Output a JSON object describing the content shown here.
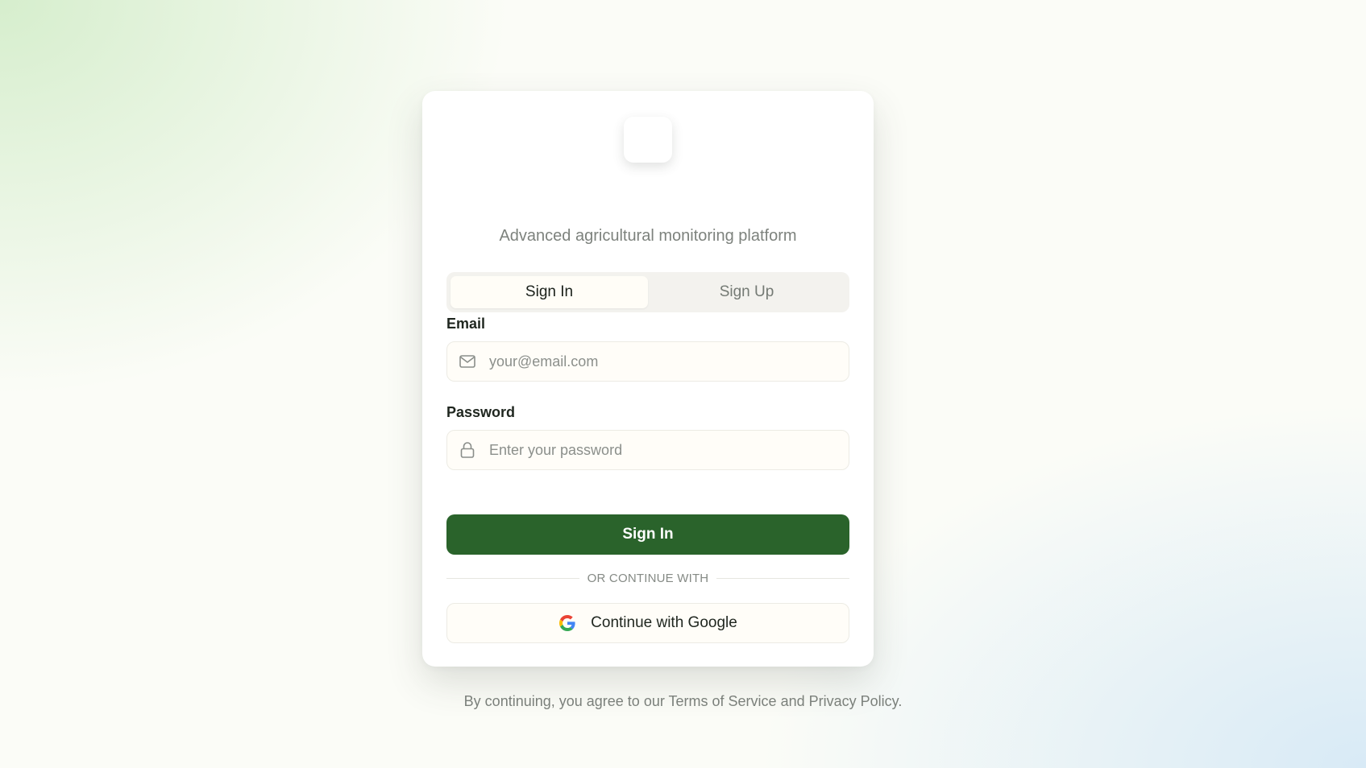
{
  "brand": {
    "subtitle": "Advanced agricultural monitoring platform",
    "logo_icon": "app-logo"
  },
  "tabs": [
    {
      "label": "Sign In",
      "active": true
    },
    {
      "label": "Sign Up",
      "active": false
    }
  ],
  "form": {
    "email_label": "Email",
    "email_placeholder": "your@email.com",
    "email_icon": "mail-icon",
    "password_label": "Password",
    "password_placeholder": "Enter your password",
    "password_icon": "lock-icon",
    "submit_label": "Sign In"
  },
  "divider_text": "OR CONTINUE WITH",
  "google_button": {
    "label": "Continue with Google",
    "icon": "google-icon"
  },
  "footer": {
    "prefix": "By continuing, you agree to our ",
    "terms": "Terms of Service",
    "middle": " and ",
    "privacy": "Privacy Policy",
    "suffix": "."
  },
  "colors": {
    "primary": "#2a632b",
    "background_green": "#d6eecd",
    "background_blue": "#d8eaf6",
    "card": "#ffffff"
  }
}
